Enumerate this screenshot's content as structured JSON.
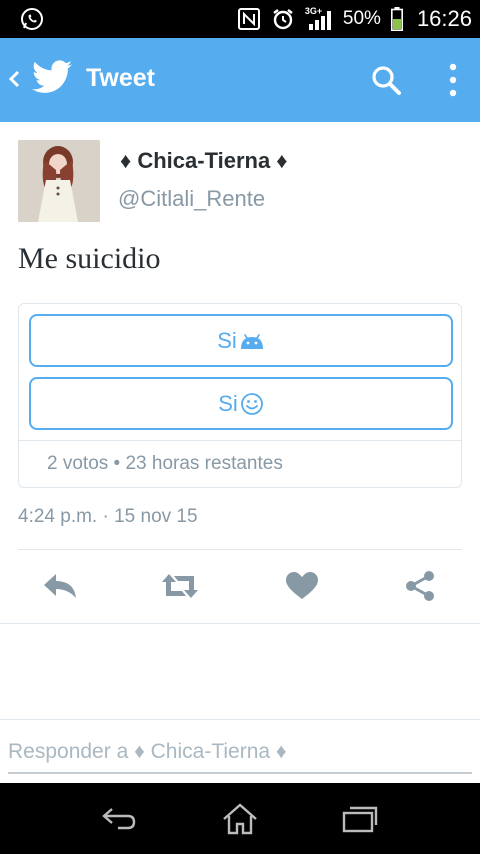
{
  "status_bar": {
    "battery_percent": "50%",
    "time": "16:26",
    "network": "3G+"
  },
  "app_bar": {
    "title": "Tweet"
  },
  "tweet": {
    "display_name": "♦ Chica-Tierna ♦",
    "handle": "@Citlali_Rente",
    "text": "Me suicidio",
    "poll": {
      "options": [
        {
          "label": "Si",
          "emoji": "android-icon"
        },
        {
          "label": "Si",
          "emoji": "smiley-icon"
        }
      ],
      "meta": "2 votos • 23 horas restantes"
    },
    "timestamp": "4:24 p.m. · 15 nov 15"
  },
  "reply": {
    "placeholder": "Responder a ♦ Chica-Tierna ♦"
  },
  "colors": {
    "accent": "#55acee",
    "text": "#292f33",
    "secondary": "#8899a6",
    "action": "#8899a6"
  }
}
